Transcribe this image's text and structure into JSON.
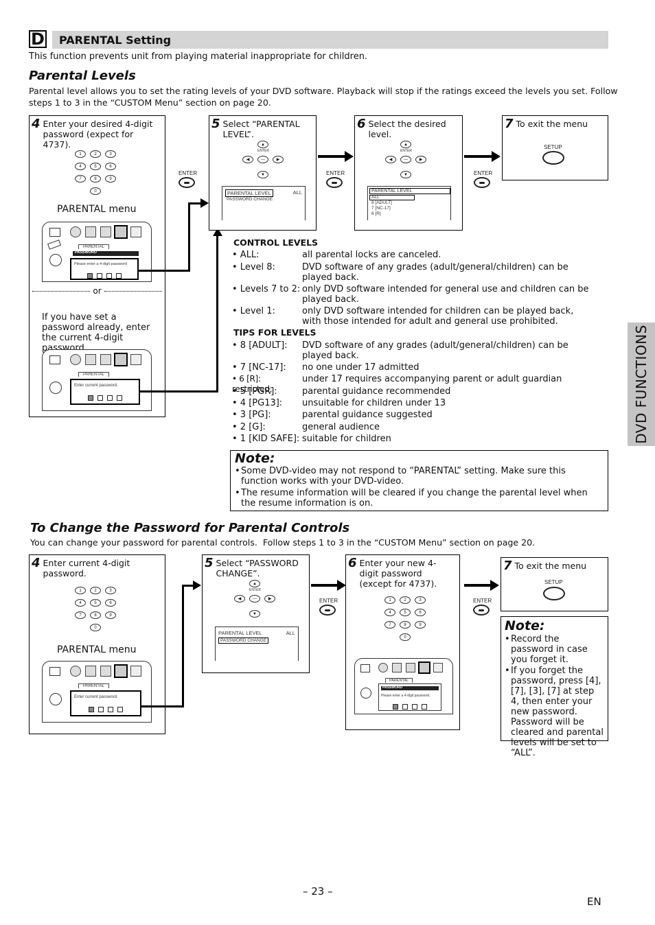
{
  "section": {
    "letter": "D",
    "title": "PARENTAL Setting",
    "intro": "This function prevents unit from playing material inappropriate for children."
  },
  "parental_levels": {
    "heading": "Parental Levels",
    "desc_line1": "Parental level allows you to set the rating levels of your DVD software. Playback will stop if the ratings exceed the levels you set. Follow",
    "desc_line2": "steps 1 to 3 in the “CUSTOM Menu” section on page 20.",
    "step4": {
      "num": "4",
      "text": "Enter your desired 4-digit password (expect for 4737).",
      "menu_label": "PARENTAL menu",
      "or_label": "or",
      "alt_text": "If you have set a password already, enter the current 4-digit password.",
      "screen1": {
        "tab": "PARENTAL",
        "bar": "PASSWORD",
        "prompt": "Please enter a 4-digit password"
      },
      "screen2": {
        "tab": "PARENTAL",
        "prompt": "Enter current password."
      }
    },
    "step5": {
      "num": "5",
      "text": "Select “PARENTAL LEVEL”.",
      "enter_label": "ENTER",
      "screen": {
        "item1": "PARENTAL LEVEL",
        "item1_value": "ALL",
        "item2": "PASSWORD CHANGE"
      }
    },
    "step6": {
      "num": "6",
      "text": "Select the desired level.",
      "enter_label": "ENTER",
      "screen": {
        "header": "PARENTAL LEVEL",
        "items": [
          "ALL",
          "8 [ADULT]",
          "7 [NC-17]",
          "6 [R]"
        ]
      }
    },
    "step7": {
      "num": "7",
      "text": "To exit the menu",
      "button_label": "SETUP"
    },
    "enter_labels": [
      "ENTER",
      "ENTER",
      "ENTER"
    ],
    "keypad": [
      "1",
      "2",
      "3",
      "4",
      "5",
      "6",
      "7",
      "8",
      "9",
      "0"
    ]
  },
  "control_levels": {
    "heading": "CONTROL LEVELS",
    "items": [
      {
        "key": "• ALL:",
        "value": "all parental locks are canceled."
      },
      {
        "key": "• Level 8:",
        "value": "DVD software of any grades (adult/general/children) can be played back."
      },
      {
        "key": "• Levels 7 to 2:",
        "value": "only DVD software intended for general use and children can be played back."
      },
      {
        "key": "• Level 1:",
        "value": "only DVD software intended for children can be played back, with those intended for adult and general use prohibited."
      }
    ]
  },
  "tips_for_levels": {
    "heading": "TIPS FOR LEVELS",
    "items": [
      {
        "key": "• 8 [ADULT]:",
        "value": "DVD software of any grades (adult/general/children) can be played back."
      },
      {
        "key": "• 7 [NC-17]:",
        "value": "no one under 17 admitted"
      },
      {
        "key": "• 6 [R]: restricted;",
        "value": "under 17 requires accompanying parent or adult guardian"
      },
      {
        "key": "• 5 [PGR]:",
        "value": "parental guidance recommended"
      },
      {
        "key": "• 4 [PG13]:",
        "value": "unsuitable for children under 13"
      },
      {
        "key": "• 3 [PG]:",
        "value": "parental guidance suggested"
      },
      {
        "key": "• 2 [G]:",
        "value": "general audience"
      },
      {
        "key": "• 1 [KID SAFE]:",
        "value": "suitable for children"
      }
    ]
  },
  "note1": {
    "title": "Note:",
    "items": [
      "Some DVD-video may not respond to “PARENTAL” setting. Make sure this function works with your DVD-video.",
      "The resume information will be cleared if you change the parental level when the resume information is on."
    ]
  },
  "change_password": {
    "heading": "To Change the Password for Parental Controls",
    "desc": "You can change your password for parental controls.  Follow steps 1 to 3 in the “CUSTOM Menu” section on page 20.",
    "step4": {
      "num": "4",
      "text": "Enter current 4-digit password.",
      "menu_label": "PARENTAL menu",
      "screen": {
        "tab": "PARENTAL",
        "prompt": "Enter current password."
      }
    },
    "step5": {
      "num": "5",
      "text": "Select “PASSWORD CHANGE”.",
      "enter_label": "ENTER",
      "screen": {
        "item1": "PARENTAL LEVEL",
        "item1_value": "ALL",
        "item2": "PASSWORD CHANGE"
      }
    },
    "step6": {
      "num": "6",
      "text": "Enter your new 4-digit password (except for 4737).",
      "screen": {
        "tab": "PARENTAL",
        "bar": "PASSWORD",
        "prompt": "Please enter a 4-digit password."
      }
    },
    "step7": {
      "num": "7",
      "text": "To exit the menu",
      "button_label": "SETUP"
    },
    "enter_labels": [
      "ENTER",
      "ENTER"
    ],
    "note": {
      "title": "Note:",
      "items": [
        "Record the password in case you forget it.",
        "If you forget the password, press [4], [7], [3], [7] at step 4, then enter your new password. Password will be cleared and parental levels will be set to “ALL”."
      ]
    }
  },
  "side_tab": "DVD FUNCTIONS",
  "footer": {
    "page": "– 23 –",
    "lang": "EN"
  }
}
